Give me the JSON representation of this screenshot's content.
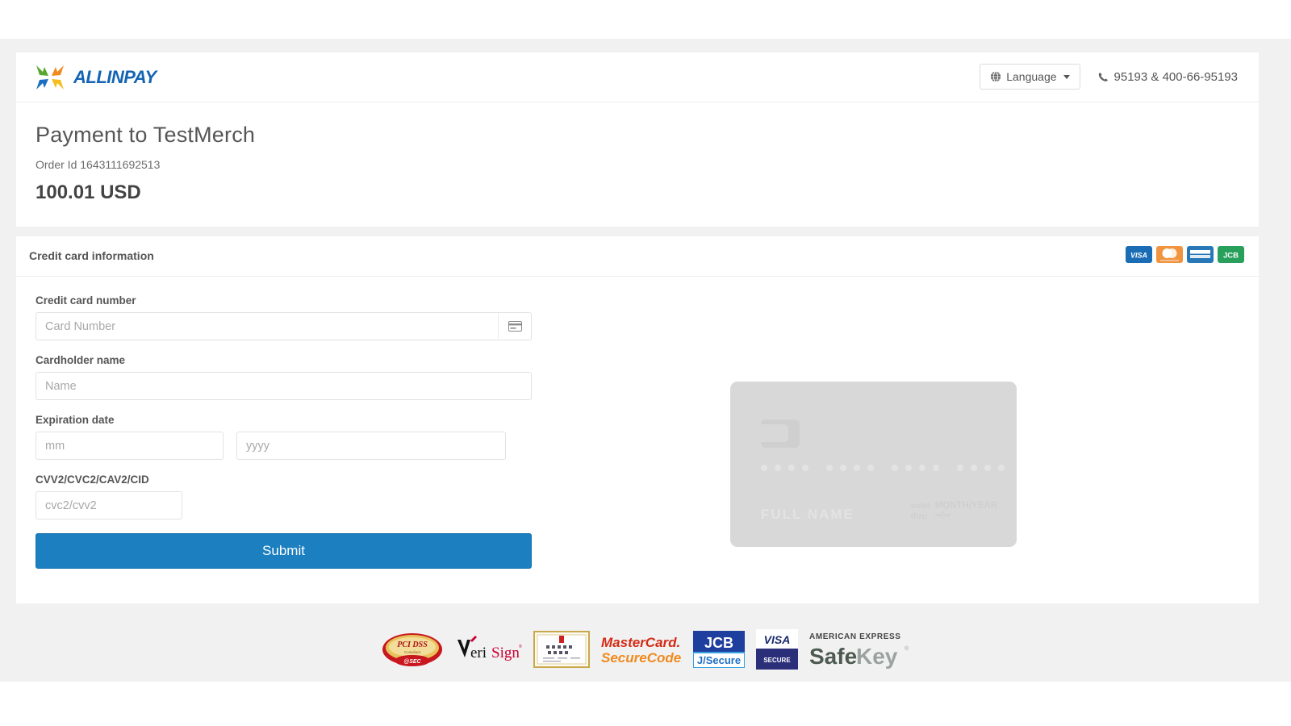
{
  "header": {
    "logo_text": "ALLINPAY",
    "logo_icon": "four-arrows-logo",
    "language_label": "Language",
    "language_icon": "globe-icon",
    "phone_icon": "phone-icon",
    "phone": "95193 & 400-66-95193"
  },
  "order": {
    "title": "Payment to TestMerch",
    "order_id": "Order Id 1643111692513",
    "amount": "100.01 USD"
  },
  "card_section": {
    "title": "Credit card information",
    "brands": [
      {
        "name": "visa-brand-icon",
        "label": "VISA",
        "color": "#1a6cb5"
      },
      {
        "name": "mastercard-brand-icon",
        "label": "Mastercard",
        "color": "#f0943f"
      },
      {
        "name": "amex-brand-icon",
        "label": "AMERICAN EXPRESS",
        "color": "#2878b8"
      },
      {
        "name": "jcb-brand-icon",
        "label": "JCB",
        "color": "#28a05c"
      }
    ]
  },
  "form": {
    "card_number": {
      "label": "Credit card number",
      "placeholder": "Card Number",
      "value": "",
      "addon_icon": "credit-card-icon"
    },
    "cardholder": {
      "label": "Cardholder name",
      "placeholder": "Name",
      "value": ""
    },
    "expiration": {
      "label": "Expiration date",
      "month_placeholder": "mm",
      "month_value": "",
      "year_placeholder": "yyyy",
      "year_value": ""
    },
    "cvv": {
      "label": "CVV2/CVC2/CAV2/CID",
      "placeholder": "cvc2/cvv2",
      "value": ""
    },
    "submit_label": "Submit",
    "submit_color": "#1b7fc0"
  },
  "card_preview": {
    "dot_groups": 4,
    "dots_per_group": 4,
    "name_text": "FULL  NAME",
    "valid_label_line1": "valid",
    "valid_label_line2": "thru",
    "valid_value_line1": "MONTH/YEAR",
    "valid_value_line2": "••/••"
  },
  "footer": {
    "badges": [
      {
        "name": "pci-dss-badge",
        "label": "PCI DSS"
      },
      {
        "name": "verisign-badge",
        "label": "VeriSign"
      },
      {
        "name": "certificate-badge",
        "label": "Certificate"
      },
      {
        "name": "mastercard-securecode-badge",
        "label": "MasterCard SecureCode"
      },
      {
        "name": "jcb-jsecure-badge",
        "label": "JCB J/Secure"
      },
      {
        "name": "visa-secure-badge",
        "label": "VISA SECURE"
      },
      {
        "name": "amex-safekey-badge",
        "label": "AMERICAN EXPRESS SafeKey"
      }
    ],
    "mastercard_line1": "MasterCard.",
    "mastercard_line2": "SecureCode.",
    "jcb_line1": "JCB",
    "jcb_line2": "J/Secure",
    "visa_line1": "VISA",
    "visa_line2": "SECURE",
    "amex_line1": "AMERICAN EXPRESS",
    "amex_line2a": "Safe",
    "amex_line2b": "Key",
    "verisign_v": "V",
    "verisign_eri": "eri",
    "verisign_sign": "Sign",
    "pci_text": "PCI DSS"
  }
}
